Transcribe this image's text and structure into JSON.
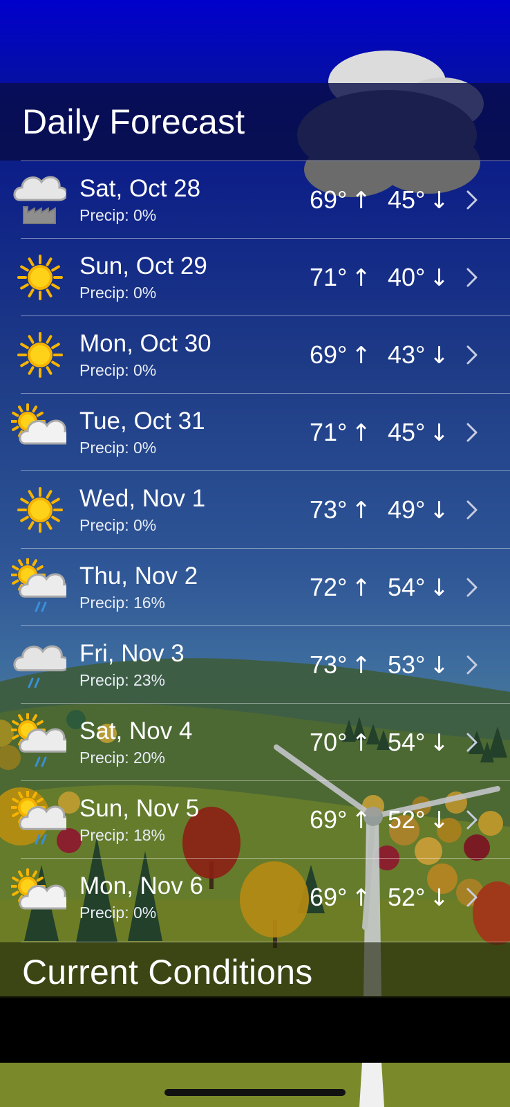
{
  "headers": {
    "daily": "Daily Forecast",
    "current": "Current Conditions"
  },
  "colors": {
    "sky_top": "#0000cc",
    "sun": "#f6b400",
    "cloud_light": "#f2f2f2",
    "cloud_dark": "#c7c7c7",
    "rain": "#3a8fd6",
    "grass": "#7a8a2a"
  },
  "forecast": [
    {
      "day": "Sat, Oct 28",
      "precip": "Precip: 0%",
      "high": "69°",
      "low": "45°",
      "icon": "cloud-factory-icon"
    },
    {
      "day": "Sun, Oct 29",
      "precip": "Precip: 0%",
      "high": "71°",
      "low": "40°",
      "icon": "sun-icon"
    },
    {
      "day": "Mon, Oct 30",
      "precip": "Precip: 0%",
      "high": "69°",
      "low": "43°",
      "icon": "sun-icon"
    },
    {
      "day": "Tue, Oct 31",
      "precip": "Precip: 0%",
      "high": "71°",
      "low": "45°",
      "icon": "partly-cloudy-icon"
    },
    {
      "day": "Wed, Nov 1",
      "precip": "Precip: 0%",
      "high": "73°",
      "low": "49°",
      "icon": "sun-icon"
    },
    {
      "day": "Thu, Nov 2",
      "precip": "Precip: 16%",
      "high": "72°",
      "low": "54°",
      "icon": "sun-cloud-rain-icon"
    },
    {
      "day": "Fri, Nov 3",
      "precip": "Precip: 23%",
      "high": "73°",
      "low": "53°",
      "icon": "cloud-rain-icon"
    },
    {
      "day": "Sat, Nov 4",
      "precip": "Precip: 20%",
      "high": "70°",
      "low": "54°",
      "icon": "sun-cloud-rain-icon"
    },
    {
      "day": "Sun, Nov 5",
      "precip": "Precip: 18%",
      "high": "69°",
      "low": "52°",
      "icon": "sun-cloud-rain-icon"
    },
    {
      "day": "Mon, Nov 6",
      "precip": "Precip: 0%",
      "high": "69°",
      "low": "52°",
      "icon": "partly-cloudy-icon"
    }
  ],
  "arrows": {
    "up": "↑",
    "down": "↓"
  }
}
